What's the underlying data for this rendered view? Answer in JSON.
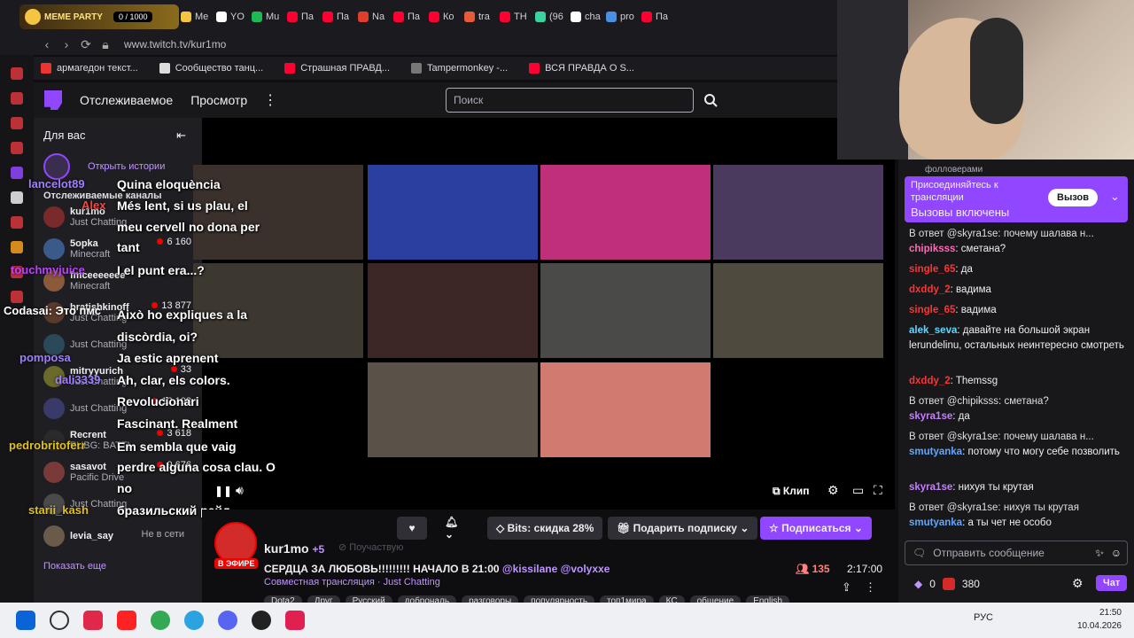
{
  "tabbar": {
    "gx_title": "MEME PARTY",
    "gx_counter": "0 / 1000",
    "tabs": [
      {
        "label": "Me",
        "color": "#f4c542"
      },
      {
        "label": "YO",
        "color": "#ffffff"
      },
      {
        "label": "Mu",
        "color": "#1db954"
      },
      {
        "label": "Па",
        "color": "#ff0033"
      },
      {
        "label": "Па",
        "color": "#ff0033"
      },
      {
        "label": "Na",
        "color": "#e03e2d"
      },
      {
        "label": "Па",
        "color": "#ff0033"
      },
      {
        "label": "Ко",
        "color": "#ff0033"
      },
      {
        "label": "tra",
        "color": "#e65a3a"
      },
      {
        "label": "TH",
        "color": "#ff0033"
      },
      {
        "label": "(96",
        "color": "#3ad29f"
      },
      {
        "label": "cha",
        "color": "#ffffff"
      },
      {
        "label": "pro",
        "color": "#4a90e2"
      },
      {
        "label": "Па",
        "color": "#ff0033"
      }
    ]
  },
  "addressbar": {
    "url": "www.twitch.tv/kur1mo"
  },
  "bookmarks": [
    {
      "label": "армагедон текст...",
      "color": "#e33"
    },
    {
      "label": "Сообщество танц...",
      "color": "#ddd"
    },
    {
      "label": "Страшная ПРАВД...",
      "color": "#ff0033"
    },
    {
      "label": "Tampermonkey -...",
      "color": "#777"
    },
    {
      "label": "ВСЯ ПРАВДА О S...",
      "color": "#ff0033"
    }
  ],
  "twitch_nav": {
    "following": "Отслеживаемое",
    "browse": "Просмотр",
    "search_placeholder": "Поиск"
  },
  "sidebar": {
    "title": "Для вас",
    "stories_label": "Открыть истории",
    "section_label": "Отслеживаемые каналы",
    "channels": [
      {
        "name": "kur1mo",
        "game": "Just Chatting",
        "viewers": ""
      },
      {
        "name": "5opka",
        "game": "Minecraft",
        "viewers": "6 160"
      },
      {
        "name": "fmceeeeeee",
        "game": "Minecraft",
        "viewers": ""
      },
      {
        "name": "bratishkinoff",
        "game": "Just Chatting",
        "viewers": "13 877"
      },
      {
        "name": "",
        "game": "Just Chatting",
        "viewers": ""
      },
      {
        "name": "mitryyurich",
        "game": "Just Chatting",
        "viewers": "33"
      },
      {
        "name": "",
        "game": "Just Chatting",
        "viewers": "12 103"
      },
      {
        "name": "Recrent",
        "game": "PUBG: BATTL",
        "viewers": "3 618"
      },
      {
        "name": "sasavot",
        "game": "Pacific Drive",
        "viewers": "9 676"
      },
      {
        "name": "",
        "game": "Just Chatting",
        "viewers": ""
      },
      {
        "name": "levia_say",
        "game": "",
        "viewers": "Не в сети"
      }
    ],
    "show_more": "Показать еще"
  },
  "overlay_chat": {
    "lines": [
      "Quina eloquència",
      "Més lent, si us plau, el",
      "meu cervell no dona per",
      "tant",
      "I el punt era...?",
      "Això ho expliques a la",
      "discòrdia, oi?",
      "Ja estic aprenent",
      "Ah, clar, els colors.",
      "Revolucionari",
      "Fascinant. Realment",
      "Em sembla que vaig",
      "perdre alguna cosa clau. O",
      "no",
      "бразильский рейд"
    ],
    "names": [
      {
        "text": "lancelot89",
        "color": "#9f7fff"
      },
      {
        "text": "Alex",
        "color": "#ff4040"
      },
      {
        "text": "touchmyjuice",
        "color": "#c040ff"
      },
      {
        "text": "Codasai: Это пмс",
        "color": "#ffffff"
      },
      {
        "text": "pomposa",
        "color": "#9f7fff"
      },
      {
        "text": "dali3339",
        "color": "#9f7fff"
      },
      {
        "text": "pedrobritoferr",
        "color": "#e0c020"
      },
      {
        "text": "starii_kash",
        "color": "#e0c020"
      }
    ]
  },
  "player": {
    "clip": "Клип"
  },
  "stream_info": {
    "channel": "kur1mo",
    "live_badge": "В ЭФИРЕ",
    "collab_count": "+5",
    "will_attend": "Поучаствую",
    "title_prefix": "СЕРДЦА ЗА ЛЮБОВЬ!!!!!!!!! НАЧАЛО В 21:00",
    "title_mentions": "@kissilane @volyxxe",
    "category_line": "Совместная трансляция · Just Chatting",
    "viewers": "135",
    "uptime": "2:17:00",
    "bits_label": "Bits: скидка 28%",
    "gift_label": "Подарить подписку",
    "subscribe_label": "Подписаться",
    "tags": [
      "Dota2",
      "Друг",
      "Русский",
      "доброналь",
      "разговоры",
      "популярность",
      "топ1мира",
      "КС",
      "общение",
      "English"
    ]
  },
  "chat": {
    "header_frag": "фолловерами",
    "banner_line1": "Присоединяйтесь к",
    "banner_line2": "трансляции",
    "banner_line3": "Вызовы включены",
    "banner_button": "Вызов",
    "messages": [
      {
        "reply": "В ответ @skyra1se: почему шалава н...",
        "user": "chipiksss",
        "user_color": "#ff69b4",
        "text": ": сметана?"
      },
      {
        "reply": "",
        "user": "single_65",
        "user_color": "#ff3333",
        "text": ": да"
      },
      {
        "reply": "",
        "user": "dxddy_2",
        "user_color": "#ff3333",
        "text": ": вадима"
      },
      {
        "reply": "",
        "user": "single_65",
        "user_color": "#ff3333",
        "text": ": вадима"
      },
      {
        "reply": "",
        "user": "alek_seva",
        "user_color": "#5fd7ff",
        "text": ": давайте на большой экран lerundelinu, остальных неинтересно смотреть"
      },
      {
        "reply": "",
        "user": "dxddy_2",
        "user_color": "#ff3333",
        "text": ": Themssg"
      },
      {
        "reply": "В ответ @chipiksss: сметана?",
        "user": "skyra1se",
        "user_color": "#c77dff",
        "text": ": да"
      },
      {
        "reply": "В ответ @skyra1se: почему шалава н...",
        "user": "smutyanka",
        "user_color": "#5fa8ff",
        "text": ": потому что могу себе позволить"
      },
      {
        "reply": "",
        "user": "skyra1se",
        "user_color": "#c77dff",
        "text": ": нихуя ты крутая"
      },
      {
        "reply": "В ответ @skyra1se: нихуя ты крутая",
        "user": "smutyanka",
        "user_color": "#5fa8ff",
        "text": ": а ты чет не особо"
      }
    ],
    "input_placeholder": "Отправить сообщение",
    "points_a": "0",
    "points_b": "380",
    "chat_button": "Чат"
  },
  "taskbar": {
    "lang": "РУС",
    "time": "21:50",
    "date": "10.04.2026"
  }
}
